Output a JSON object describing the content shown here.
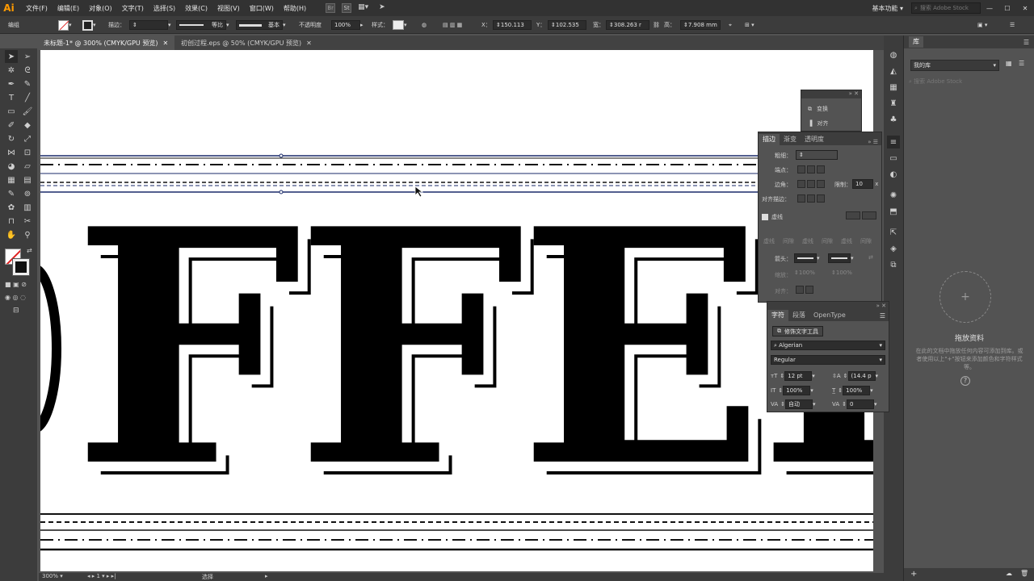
{
  "app": {
    "logo": "Ai"
  },
  "menu": [
    "文件(F)",
    "编辑(E)",
    "对象(O)",
    "文字(T)",
    "选择(S)",
    "效果(C)",
    "视图(V)",
    "窗口(W)",
    "帮助(H)"
  ],
  "workspace": {
    "label": "基本功能"
  },
  "search": {
    "placeholder": "搜索 Adobe Stock"
  },
  "control": {
    "mode_label": "编组",
    "stroke_label": "描边：",
    "stroke_profile": "等比",
    "brush": "基本",
    "opacity_label": "不透明度",
    "opacity_value": "100%",
    "style_label": "样式：",
    "x_label": "X：",
    "x_value": "150.113",
    "y_label": "Y：",
    "y_value": "102.535",
    "w_label": "宽：",
    "w_value": "308.263 r",
    "h_label": "高：",
    "h_value": "7.908 mm"
  },
  "tabs": [
    {
      "label": "未标题-1* @ 300% (CMYK/GPU 预览)",
      "active": true
    },
    {
      "label": "初创过程.eps @ 50% (CMYK/GPU 预览)",
      "active": false
    }
  ],
  "canvas": {
    "text": "FFEE"
  },
  "transform_panel": {
    "items": [
      "变换",
      "对齐"
    ]
  },
  "stroke_panel": {
    "tabs": [
      "描边",
      "渐变",
      "透明度"
    ],
    "weight_label": "粗细：",
    "cap_label": "端点：",
    "corner_label": "边角：",
    "limit_label": "限制：",
    "limit_value": "10",
    "limit_unit": "x",
    "align_label": "对齐描边：",
    "dashed_label": "虚线",
    "dash_cols": [
      "虚线",
      "间隙",
      "虚线",
      "间隙",
      "虚线",
      "间隙"
    ],
    "arrow_label": "箭头：",
    "scale_label": "缩放：",
    "scale_a": "100%",
    "scale_b": "100%",
    "align2_label": "对齐："
  },
  "char_panel": {
    "tabs": [
      "字符",
      "段落",
      "OpenType"
    ],
    "touch_tool": "修饰文字工具",
    "font_family": "Algerian",
    "font_style": "Regular",
    "size": "12 pt",
    "leading": "(14.4 p",
    "v_scale": "100%",
    "h_scale": "100%",
    "tracking_auto": "自动",
    "tracking": "0"
  },
  "libraries": {
    "title": "库",
    "dropdown": "我的库",
    "search_placeholder": "搜索 Adobe Stock",
    "drop_title": "拖放资料",
    "drop_desc": "在此的文档中拖放任何内容可添加到库。或者使用以上\"+\"按钮来添加颜色和字符样式等。"
  },
  "status": {
    "zoom": "300%",
    "page": "1",
    "tool": "选择"
  }
}
